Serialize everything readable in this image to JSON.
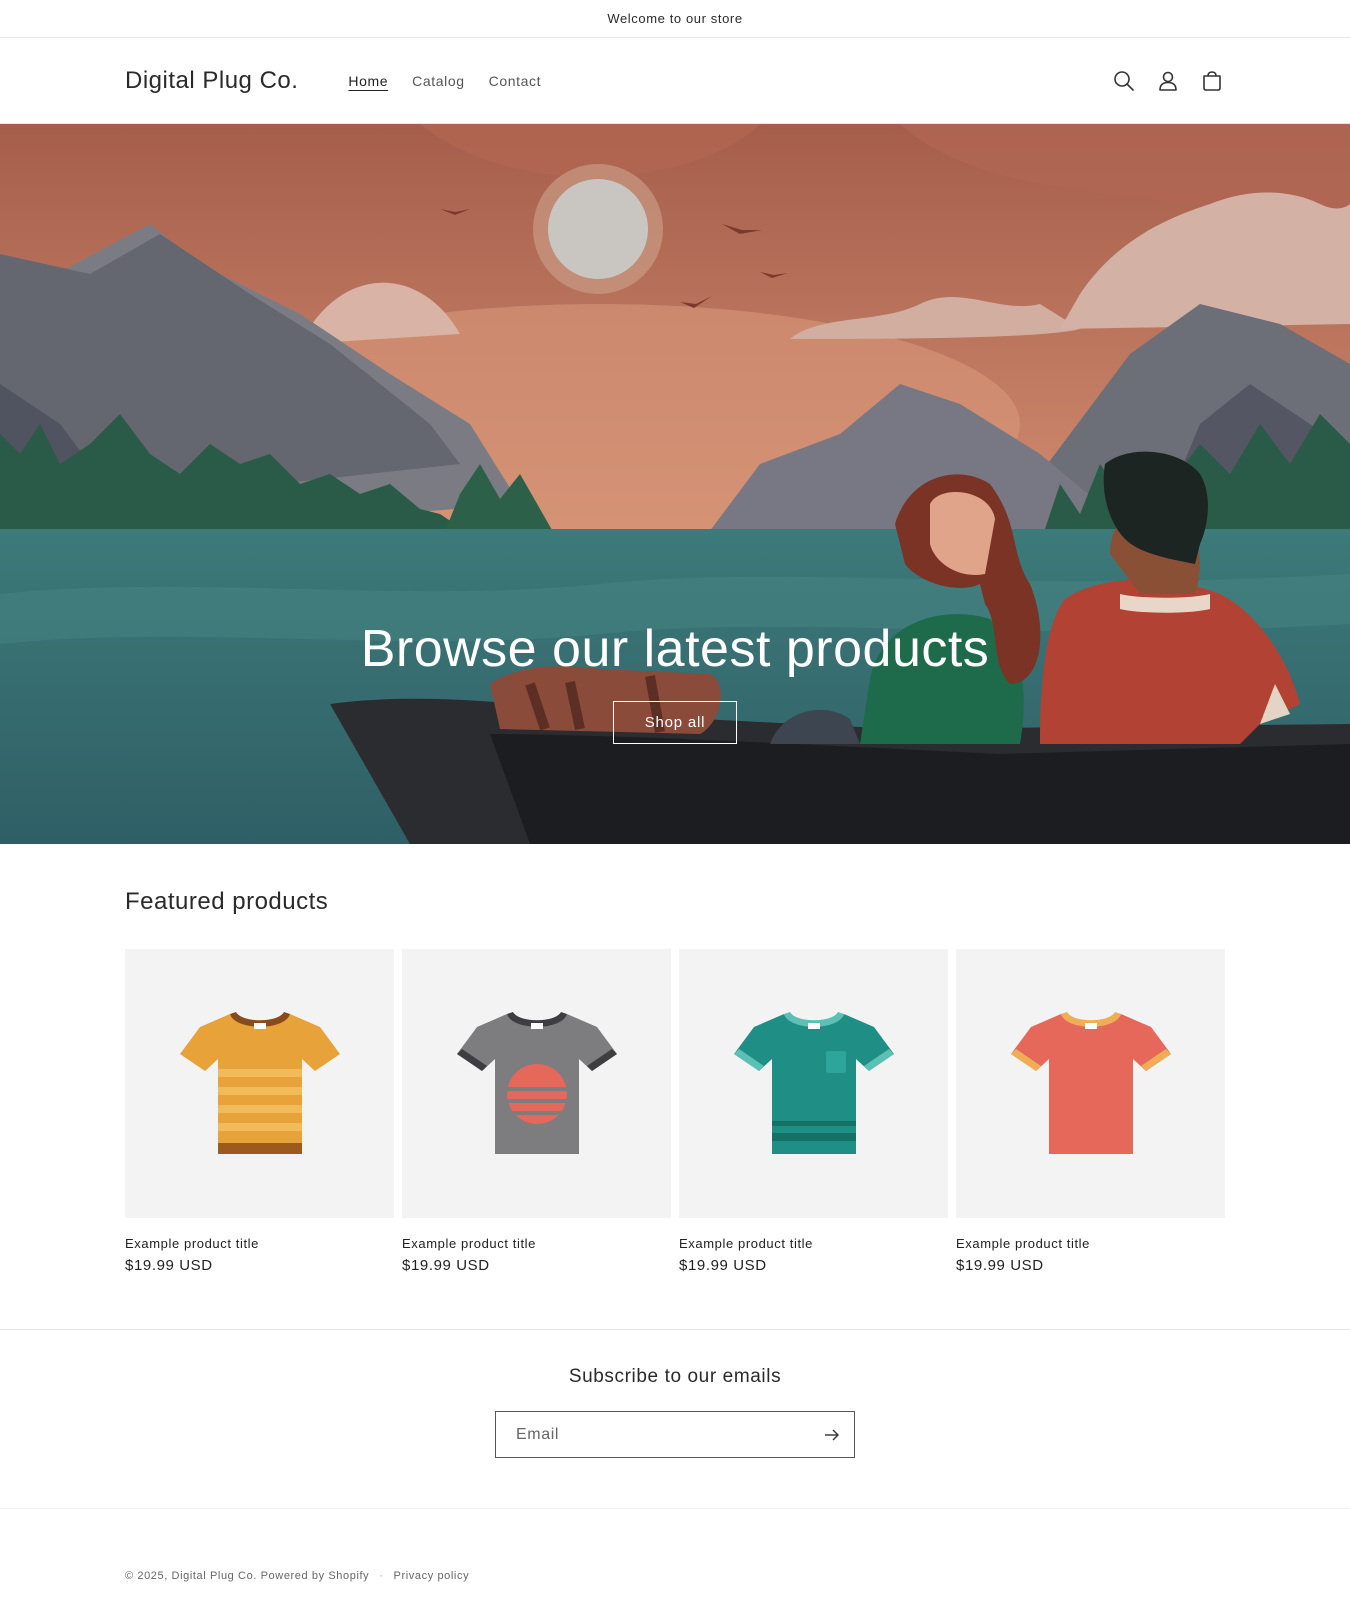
{
  "announcement": {
    "text": "Welcome to our store"
  },
  "header": {
    "logo": "Digital Plug Co.",
    "nav": [
      {
        "label": "Home",
        "active": true
      },
      {
        "label": "Catalog",
        "active": false
      },
      {
        "label": "Contact",
        "active": false
      }
    ],
    "icons": [
      "search-icon",
      "account-icon",
      "cart-icon"
    ]
  },
  "hero": {
    "title": "Browse our latest products",
    "button": "Shop all"
  },
  "featured": {
    "title": "Featured products",
    "products": [
      {
        "title": "Example product title",
        "price": "$19.99 USD",
        "color": "#e8a23a"
      },
      {
        "title": "Example product title",
        "price": "$19.99 USD",
        "color": "#7d7d7f"
      },
      {
        "title": "Example product title",
        "price": "$19.99 USD",
        "color": "#1f8f86"
      },
      {
        "title": "Example product title",
        "price": "$19.99 USD",
        "color": "#e6685a"
      }
    ]
  },
  "newsletter": {
    "title": "Subscribe to our emails",
    "placeholder": "Email"
  },
  "footer": {
    "copyright": "© 2025,",
    "brand": "Digital Plug Co.",
    "powered": "Powered by Shopify",
    "separator": "·",
    "privacy": "Privacy policy"
  }
}
